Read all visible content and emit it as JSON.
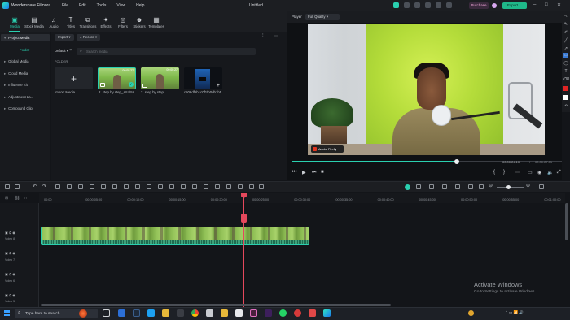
{
  "app": {
    "name": "Wondershare Filmora",
    "menu": [
      "File",
      "Edit",
      "Tools",
      "View",
      "Help"
    ],
    "document_title": "Untitled",
    "purchase_label": "Purchase",
    "export_label": "Export"
  },
  "toolbar": {
    "items": [
      {
        "label": "Media",
        "icon": "media-icon"
      },
      {
        "label": "Stock Media",
        "icon": "stock-media-icon"
      },
      {
        "label": "Audio",
        "icon": "music-note-icon"
      },
      {
        "label": "Titles",
        "icon": "text-icon"
      },
      {
        "label": "Transitions",
        "icon": "transitions-icon"
      },
      {
        "label": "Effects",
        "icon": "effects-icon"
      },
      {
        "label": "Filters",
        "icon": "filters-icon"
      },
      {
        "label": "Stickers",
        "icon": "stickers-icon"
      },
      {
        "label": "Templates",
        "icon": "templates-icon"
      }
    ]
  },
  "sidebar": {
    "items": [
      {
        "label": "Project Media"
      },
      {
        "label": "Folder"
      },
      {
        "label": "Global Media"
      },
      {
        "label": "Cloud Media"
      },
      {
        "label": "Influence Kit"
      },
      {
        "label": "Adjustment La..."
      },
      {
        "label": "Compound Clip"
      }
    ]
  },
  "media": {
    "import_label": "Import",
    "record_label": "Record",
    "default_label": "Default",
    "search_placeholder": "Search media",
    "folder_heading": "FOLDER",
    "import_tile_label": "Import Media",
    "tiles": [
      {
        "caption": "2. step by step_AIUltra...",
        "duration": "00:00:27"
      },
      {
        "caption": "2. step by step",
        "duration": "00:00:27"
      },
      {
        "caption": "c506df5b1c0f1fb0db1b5..."
      }
    ]
  },
  "player": {
    "label": "Player",
    "quality": "Full Quality",
    "badge": "Adobe Firefly",
    "current_time": "00:00:24:10",
    "total_time": "00:00:27:01",
    "progress": 0.61
  },
  "timeline": {
    "ruler_ticks": [
      "00:00",
      "00:00:05:00",
      "00:00:10:00",
      "00:00:15:00",
      "00:00:20:00",
      "00:00:25:00",
      "00:00:30:00",
      "00:00:35:00",
      "00:00:40:00",
      "00:00:45:00",
      "00:00:50:00",
      "00:00:55:00",
      "00:01:00:00"
    ],
    "tracks": [
      "Video 8",
      "Video 7",
      "Video 6",
      "Video 5"
    ]
  },
  "watermark": {
    "line1": "Activate Windows",
    "line2": "Go to Settings to activate Windows."
  },
  "taskbar": {
    "search_placeholder": "Type here to search"
  },
  "colors": {
    "accent": "#2ad0b0",
    "playhead": "#e5485c",
    "export": "#1fb889"
  }
}
